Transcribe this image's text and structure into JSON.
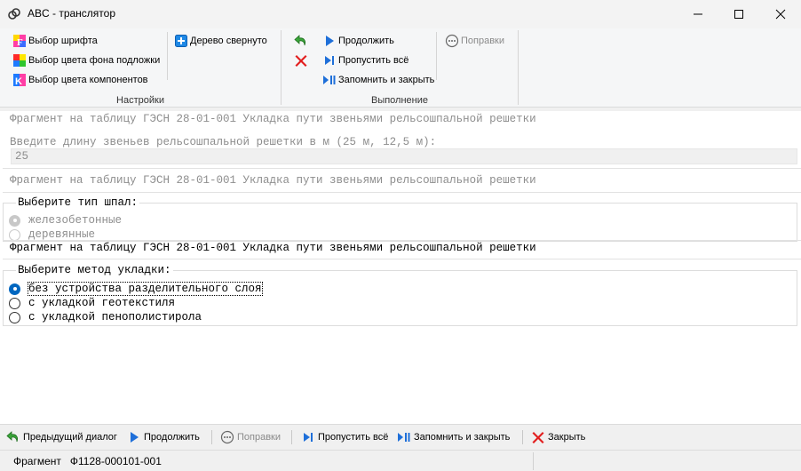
{
  "window": {
    "title": "ABC - транслятор",
    "icon": "chain-link-icon"
  },
  "ribbon": {
    "settings": {
      "label": "Настройки",
      "font_button": "Выбор шрифта",
      "bgcolor_button": "Выбор цвета фона подложки",
      "compcolor_button": "Выбор цвета компонентов",
      "tree_button": "Дерево свернуто"
    },
    "execution": {
      "label": "Выполнение",
      "continue_button": "Продолжить",
      "skip_all_button": "Пропустить всё",
      "save_close_button": "Запомнить и закрыть",
      "fixes_button": "Поправки"
    }
  },
  "content": {
    "fragment_line": "Фрагмент на таблицу ГЭСН 28-01-001 Укладка пути звеньями рельсошпальной решетки",
    "length_prompt": "Введите длину звеньев рельсошпальной решетки в м (25 м, 12,5 м):",
    "length_value": "25",
    "sleeper_group": {
      "legend": "Выберите тип шпал:",
      "options": [
        "железобетонные",
        "деревянные"
      ],
      "selected": 0
    },
    "method_group": {
      "legend": "Выберите метод укладки:",
      "options": [
        "без устройства разделительного слоя",
        "с укладкой геотекстиля",
        "с укладкой пенополистирола"
      ],
      "selected": 0
    }
  },
  "bottombar": {
    "prev_dialog": "Предыдущий диалог",
    "continue": "Продолжить",
    "fixes": "Поправки",
    "skip_all": "Пропустить всё",
    "save_close": "Запомнить и закрыть",
    "close": "Закрыть"
  },
  "status": {
    "text": "Фрагмент   Ф1128-000101-001"
  }
}
